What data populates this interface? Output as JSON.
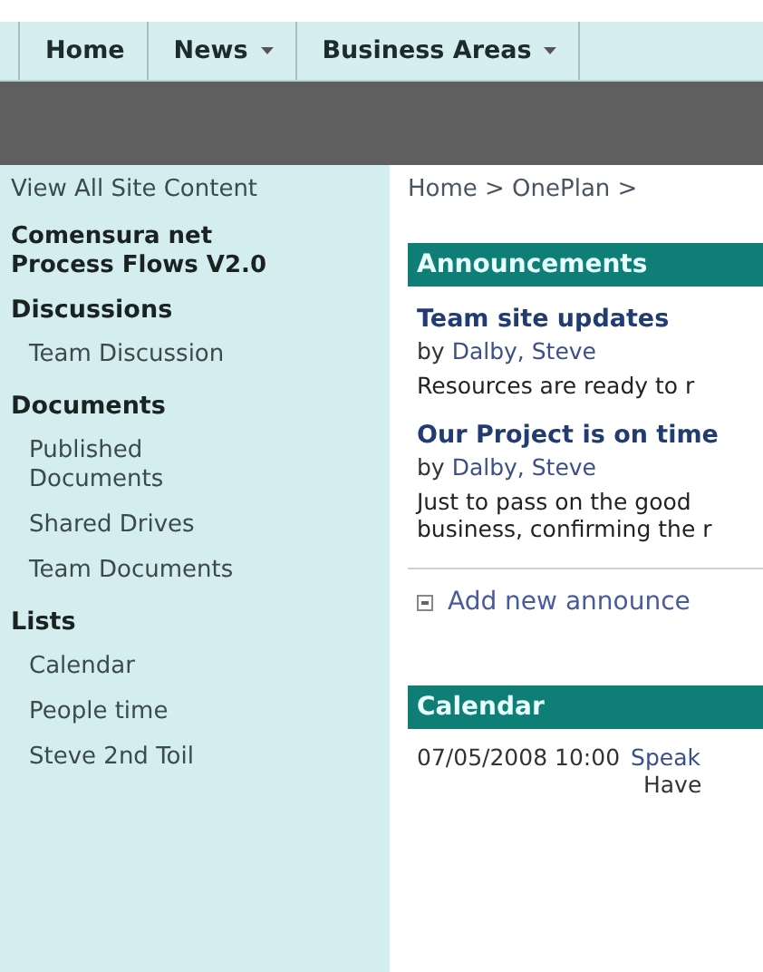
{
  "top_nav": [
    {
      "label": "Home",
      "dropdown": false
    },
    {
      "label": "News",
      "dropdown": true
    },
    {
      "label": "Business Areas",
      "dropdown": true
    }
  ],
  "sidebar": {
    "view_all": "View All Site Content",
    "site_title": "Comensura net Process Flows V2.0",
    "sections": [
      {
        "heading": "Discussions",
        "items": [
          "Team Discussion"
        ]
      },
      {
        "heading": "Documents",
        "items": [
          "Published Documents",
          "Shared Drives",
          "Team Documents"
        ]
      },
      {
        "heading": "Lists",
        "items": [
          "Calendar",
          "People time",
          "Steve 2nd Toil"
        ]
      }
    ]
  },
  "breadcrumb": "Home > OnePlan >",
  "announcements": {
    "title": "Announcements",
    "items": [
      {
        "title": "Team site updates",
        "by": "by",
        "author": "Dalby, Steve",
        "body": [
          "Resources are ready to r"
        ]
      },
      {
        "title": "Our Project is on time",
        "by": "by",
        "author": "Dalby, Steve",
        "body": [
          "Just to pass on the good",
          "business, confirming the r"
        ]
      }
    ],
    "add_link": "Add new announce"
  },
  "calendar": {
    "title": "Calendar",
    "events": [
      {
        "when": "07/05/2008 10:00",
        "title": "Speak",
        "detail": "Have"
      }
    ]
  }
}
